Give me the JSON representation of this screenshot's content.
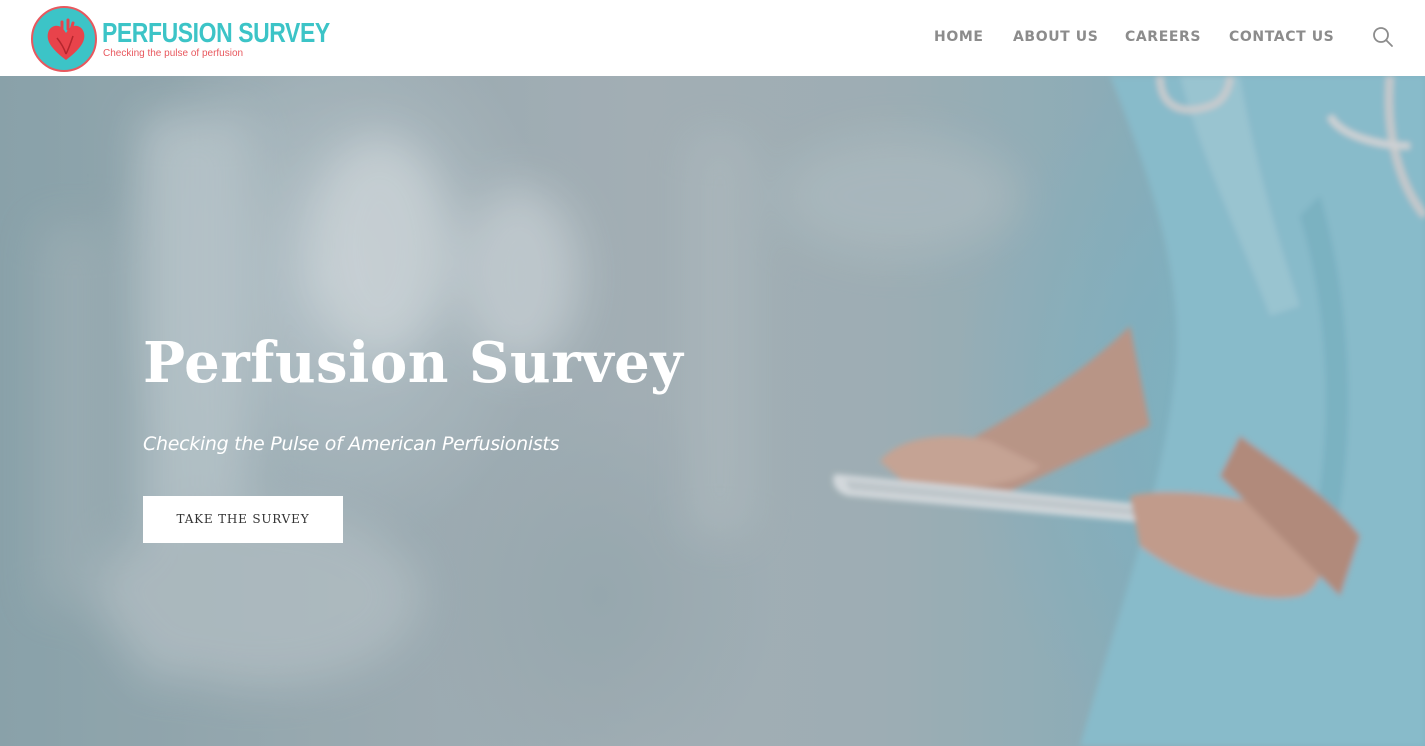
{
  "brand": {
    "name": "PERFUSION SURVEY",
    "tagline": "Checking the pulse of perfusion",
    "colors": {
      "primary": "#3cc4c7",
      "accent": "#e8585e"
    },
    "icon": "heart-icon"
  },
  "nav": {
    "items": [
      {
        "label": "HOME"
      },
      {
        "label": "ABOUT US"
      },
      {
        "label": "CAREERS"
      },
      {
        "label": "CONTACT US"
      }
    ],
    "search_icon": "search-icon"
  },
  "hero": {
    "title": "Perfusion Survey",
    "subtitle": "Checking the  Pulse of American  Perfusionists",
    "cta_label": "TAKE THE SURVEY"
  }
}
